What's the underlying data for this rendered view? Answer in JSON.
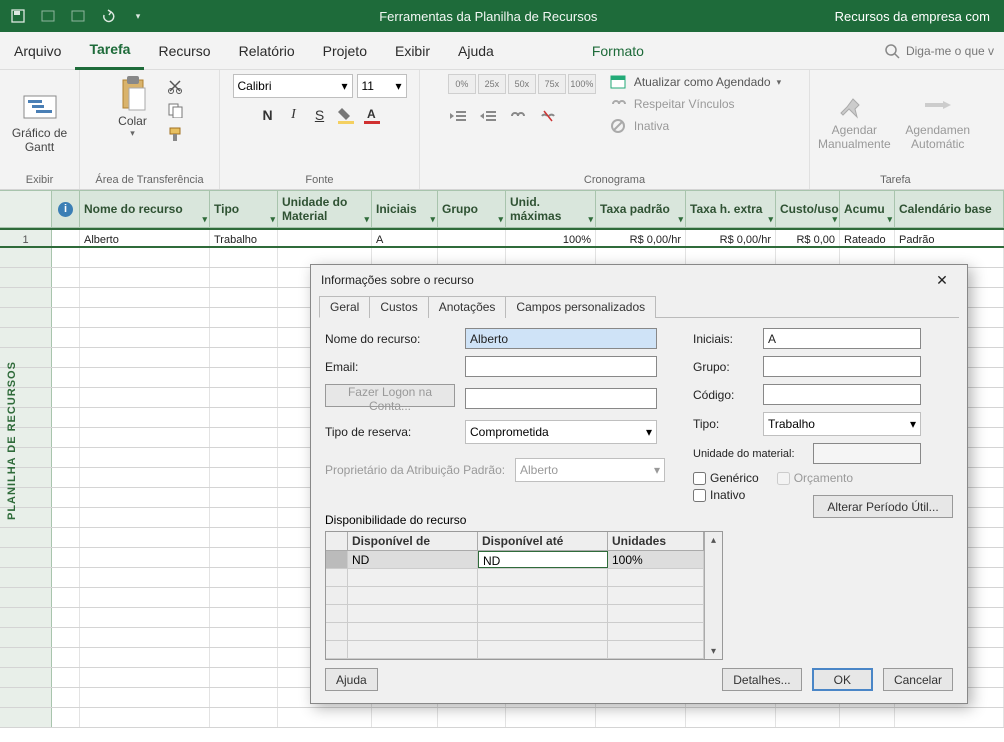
{
  "titlebar": {
    "tool_context": "Ferramentas da Planilha de Recursos",
    "doc": "Recursos da empresa com"
  },
  "menus": {
    "arquivo": "Arquivo",
    "tarefa": "Tarefa",
    "recurso": "Recurso",
    "relatorio": "Relatório",
    "projeto": "Projeto",
    "exibir": "Exibir",
    "ajuda": "Ajuda",
    "formato": "Formato",
    "tellme": "Diga-me o que v"
  },
  "ribbon": {
    "exibir": {
      "label": "Exibir",
      "gantt": "Gráfico de\nGantt"
    },
    "clipboard": {
      "label": "Área de Transferência",
      "colar": "Colar"
    },
    "fonte": {
      "label": "Fonte",
      "font": "Calibri",
      "size": "11"
    },
    "crono": {
      "label": "Cronograma",
      "zoom": [
        "0%",
        "25x",
        "50x",
        "75x",
        "100%"
      ],
      "atualizar": "Atualizar como Agendado",
      "respeitar": "Respeitar Vínculos",
      "inativa": "Inativa"
    },
    "agendar": {
      "label": "Tarefa",
      "manual": "Agendar\nManualmente",
      "auto": "Agendamen\nAutomátic"
    }
  },
  "grid": {
    "headers": {
      "nome": "Nome do recurso",
      "tipo": "Tipo",
      "unidade": "Unidade do Material",
      "iniciais": "Iniciais",
      "grupo": "Grupo",
      "unidmax": "Unid. máximas",
      "taxa": "Taxa padrão",
      "taxah": "Taxa h. extra",
      "custo": "Custo/uso",
      "acumu": "Acumu",
      "cal": "Calendário base"
    },
    "row1": {
      "num": "1",
      "nome": "Alberto",
      "tipo": "Trabalho",
      "iniciais": "A",
      "unidmax": "100%",
      "taxa": "R$ 0,00/hr",
      "taxah": "R$ 0,00/hr",
      "custo": "R$ 0,00",
      "acumu": "Rateado",
      "cal": "Padrão"
    }
  },
  "sidelabel": "PLANILHA DE RECURSOS",
  "dialog": {
    "title": "Informações sobre o recurso",
    "tabs": {
      "geral": "Geral",
      "custos": "Custos",
      "anot": "Anotações",
      "campos": "Campos personalizados"
    },
    "labels": {
      "nome": "Nome do recurso:",
      "email": "Email:",
      "logon": "Fazer Logon na Conta...",
      "reserva": "Tipo de reserva:",
      "owner": "Proprietário da Atribuição Padrão:",
      "iniciais": "Iniciais:",
      "grupo": "Grupo:",
      "codigo": "Código:",
      "tipo": "Tipo:",
      "umat": "Unidade do material:",
      "generico": "Genérico",
      "orcamento": "Orçamento",
      "inativo": "Inativo",
      "disp": "Disponibilidade do recurso",
      "dispde": "Disponível de",
      "dispate": "Disponível até",
      "unidades": "Unidades",
      "alterar": "Alterar Período Útil...",
      "ajuda": "Ajuda",
      "detalhes": "Detalhes...",
      "ok": "OK",
      "cancelar": "Cancelar"
    },
    "values": {
      "nome": "Alberto",
      "reserva": "Comprometida",
      "owner": "Alberto",
      "iniciais": "A",
      "tipo": "Trabalho",
      "dispde": "ND",
      "dispate": "ND",
      "unidades": "100%"
    }
  }
}
